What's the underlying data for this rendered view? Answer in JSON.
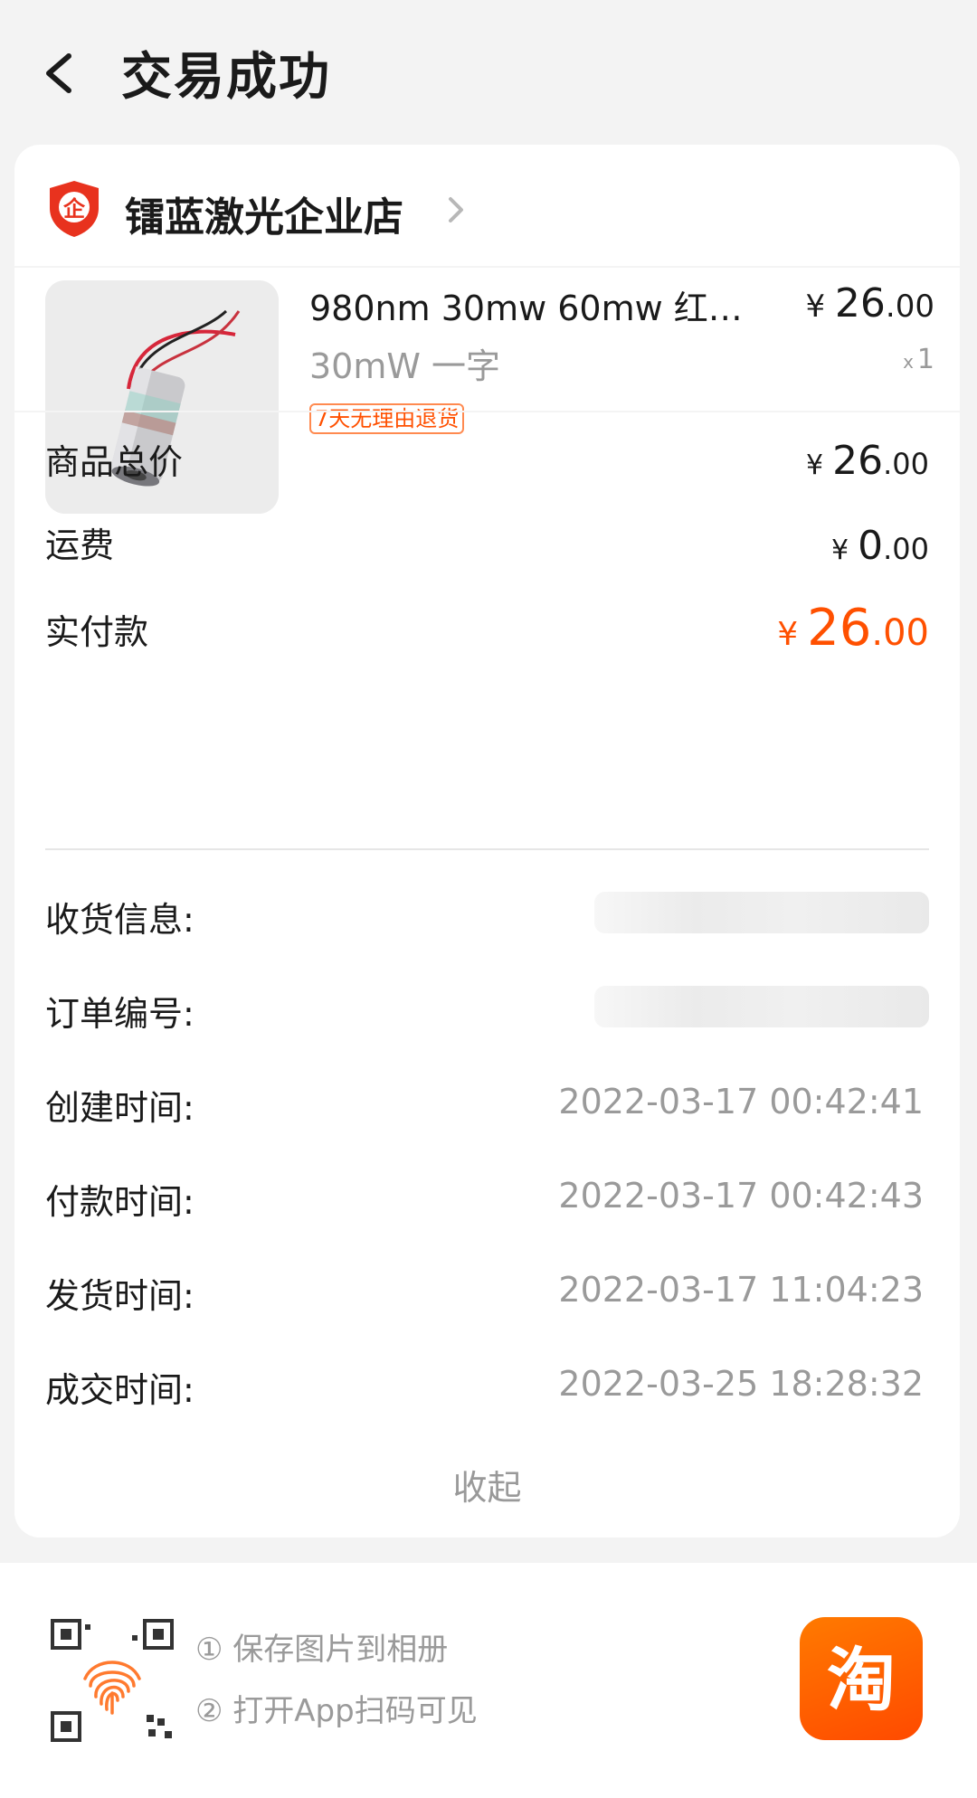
{
  "header": {
    "title": "交易成功"
  },
  "store": {
    "name": "镭蓝激光企业店",
    "logo_char": "企"
  },
  "product": {
    "title": "980nm 30mw 60mw 红…",
    "spec": "30mW 一字",
    "tag": "7天无理由退货",
    "price_symbol": "¥",
    "price_int": "26",
    "price_dec": ".00",
    "qty_prefix": "x",
    "qty": "1"
  },
  "summary": {
    "goods_total": {
      "label": "商品总价",
      "symbol": "¥",
      "int": "26",
      "dec": ".00"
    },
    "shipping": {
      "label": "运费",
      "symbol": "¥",
      "int": "0",
      "dec": ".00"
    },
    "paid": {
      "label": "实付款",
      "symbol": "¥",
      "int": "26",
      "dec": ".00"
    }
  },
  "info": {
    "receiver": {
      "label": "收货信息:"
    },
    "order_no": {
      "label": "订单编号:"
    },
    "created": {
      "label": "创建时间:",
      "value": "2022-03-17 00:42:41"
    },
    "paid": {
      "label": "付款时间:",
      "value": "2022-03-17 00:42:43"
    },
    "shipped": {
      "label": "发货时间:",
      "value": "2022-03-17 11:04:23"
    },
    "completed": {
      "label": "成交时间:",
      "value": "2022-03-25 18:28:32"
    }
  },
  "collapse_label": "收起",
  "footer": {
    "hint1": "① 保存图片到相册",
    "hint2": "② 打开App扫码可见",
    "app_char": "淘"
  },
  "colors": {
    "accent": "#ff5000",
    "background": "#f3f3f3",
    "card": "#ffffff",
    "muted": "#9a9a9a"
  }
}
